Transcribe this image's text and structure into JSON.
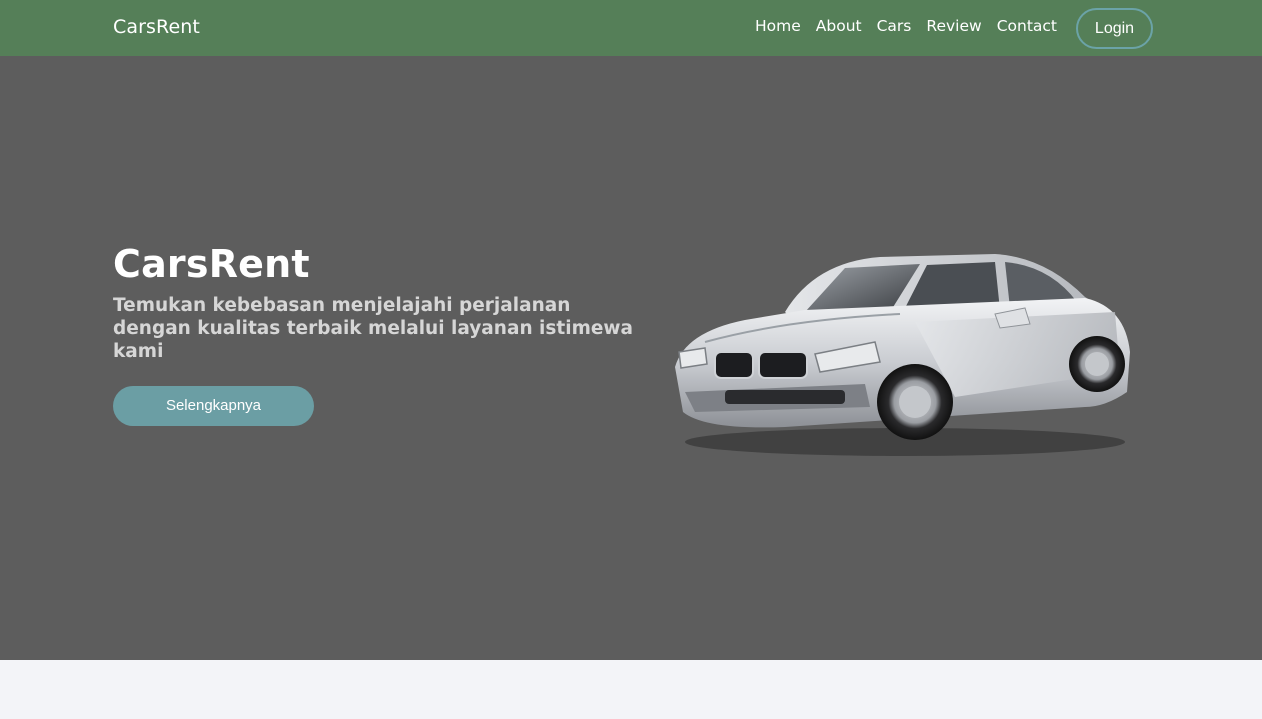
{
  "navbar": {
    "brand": "CarsRent",
    "links": [
      {
        "label": "Home"
      },
      {
        "label": "About"
      },
      {
        "label": "Cars"
      },
      {
        "label": "Review"
      },
      {
        "label": "Contact"
      }
    ],
    "login_label": "Login"
  },
  "hero": {
    "title": "CarsRent",
    "subtitle": "Temukan kebebasan menjelajahi perjalanan dengan kualitas terbaik melalui layanan istimewa kami",
    "cta_label": "Selengkapnya",
    "image": "silver-sedan-car"
  },
  "colors": {
    "navbar_bg": "#557f58",
    "hero_bg": "#5d5d5d",
    "accent": "#6b9ea4",
    "page_bg": "#f3f4f8"
  }
}
